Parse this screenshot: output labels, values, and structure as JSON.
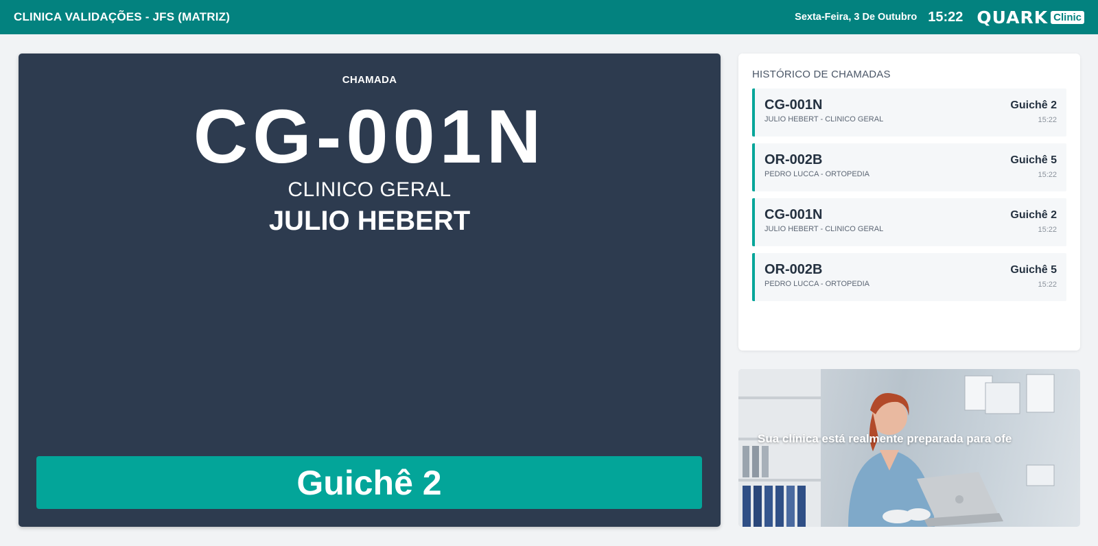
{
  "header": {
    "clinic_title": "CLINICA VALIDAÇÕES - JFS (MATRIZ)",
    "date": "Sexta-Feira, 3 De Outubro",
    "time": "15:22",
    "logo_text": "QUARK",
    "logo_badge": "Clinic"
  },
  "current_call": {
    "label": "CHAMADA",
    "ticket": "CG-001N",
    "specialty": "CLINICO GERAL",
    "patient": "JULIO HEBERT",
    "counter": "Guichê 2"
  },
  "history": {
    "title": "HISTÓRICO DE CHAMADAS",
    "items": [
      {
        "ticket": "CG-001N",
        "subtitle": "JULIO HEBERT - CLINICO GERAL",
        "counter": "Guichê 2",
        "time": "15:22"
      },
      {
        "ticket": "OR-002B",
        "subtitle": "PEDRO LUCCA - ORTOPEDIA",
        "counter": "Guichê 5",
        "time": "15:22"
      },
      {
        "ticket": "CG-001N",
        "subtitle": "JULIO HEBERT - CLINICO GERAL",
        "counter": "Guichê 2",
        "time": "15:22"
      },
      {
        "ticket": "OR-002B",
        "subtitle": "PEDRO LUCCA - ORTOPEDIA",
        "counter": "Guichê 5",
        "time": "15:22"
      }
    ]
  },
  "promo": {
    "text": "Sua clínica está realmente preparada para ofe"
  },
  "colors": {
    "header_bg": "#03827f",
    "accent": "#03a599",
    "panel_bg": "#2d3b4f"
  }
}
